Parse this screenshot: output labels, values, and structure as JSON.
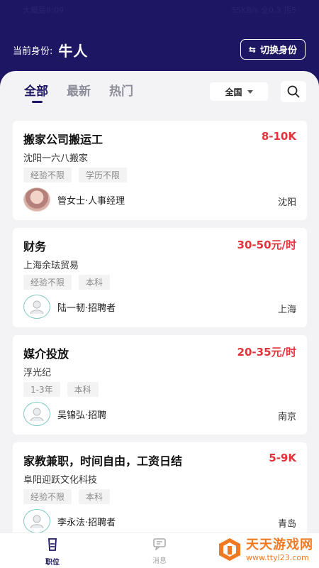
{
  "status": {
    "left": "大概是8:09",
    "right": "55KB/s  全0.3 顶5"
  },
  "identity": {
    "label": "当前身份:",
    "value": "牛人",
    "switch_label": "切换身份",
    "switch_icon": "swap-arrows-icon"
  },
  "tabs": [
    {
      "label": "全部",
      "active": true
    },
    {
      "label": "最新"
    },
    {
      "label": "热门"
    }
  ],
  "region": {
    "label": "全国"
  },
  "jobs": [
    {
      "title": "搬家公司搬运工",
      "salary": "8-10K",
      "company": "沈阳一六八搬家",
      "tags": [
        "经验不限",
        "学历不限"
      ],
      "recruiter": "管女士·人事经理",
      "city": "沈阳",
      "avatar": "photo"
    },
    {
      "title": "财务",
      "salary": "30-50元/时",
      "company": "上海余珐贸易",
      "tags": [
        "经验不限",
        "本科"
      ],
      "recruiter": "陆一韧·招聘者",
      "city": "上海",
      "avatar": "default"
    },
    {
      "title": "媒介投放",
      "salary": "20-35元/时",
      "company": "浮光纪",
      "tags": [
        "1-3年",
        "本科"
      ],
      "recruiter": "吴锦弘·招聘",
      "city": "南京",
      "avatar": "default"
    },
    {
      "title": "家教兼职，时间自由，工资日结",
      "salary": "5-9K",
      "company": "阜阳迎跃文化科技",
      "tags": [
        "经验不限",
        "本科"
      ],
      "recruiter": "李永法·招聘者",
      "city": "青岛",
      "avatar": "default"
    }
  ],
  "nav": [
    {
      "label": "职位",
      "icon": "briefcase-icon",
      "active": true
    },
    {
      "label": "消息",
      "icon": "message-icon"
    }
  ],
  "watermark": {
    "title": "天天游戏网",
    "url": "www.ttyl23.com"
  },
  "colors": {
    "brand": "#1d1763",
    "salary": "#e2323a",
    "background": "#f3f3f5"
  }
}
